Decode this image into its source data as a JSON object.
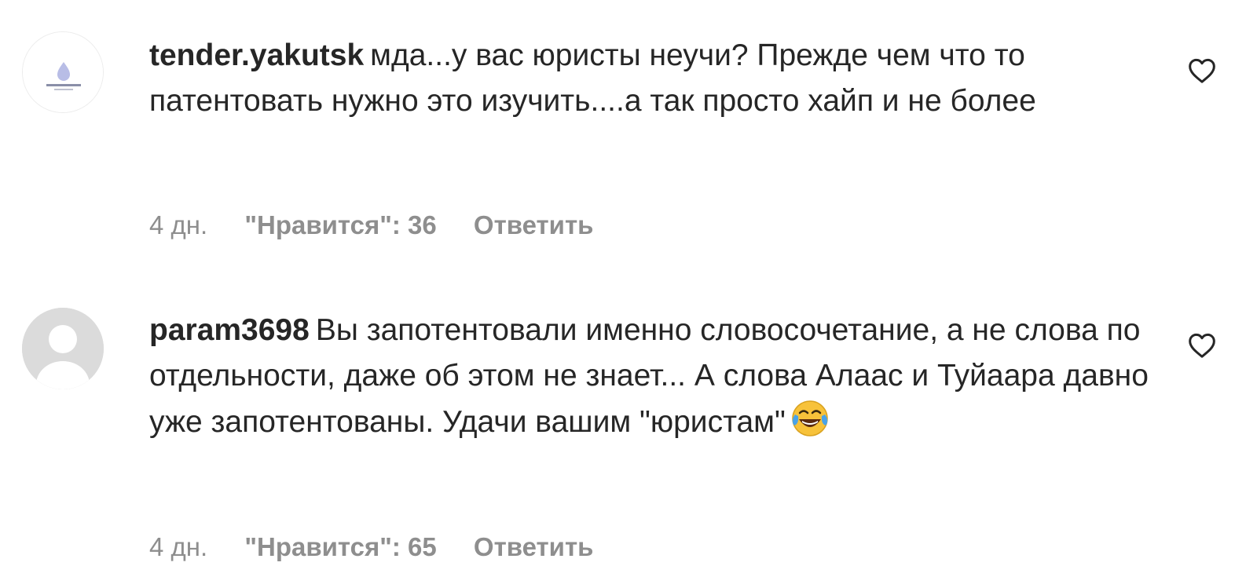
{
  "comments": [
    {
      "username": "tender.yakutsk",
      "text": "мда...у вас юристы неучи? Прежде чем что то патентовать нужно это изучить....а так просто хайп и не более",
      "time": "4 дн.",
      "likes": "\"Нравится\": 36",
      "reply_label": "Ответить",
      "avatar_icon": "logo-avatar",
      "like_icon": "heart-outline-icon"
    },
    {
      "username": "param3698",
      "text": "Вы запотентовали именно словосочетание, а не слова по отдельности, даже об этом не знает... А слова Алаас и Туйаара давно уже запотентованы. Удачи вашим \"юристам\"",
      "emoji": "laughing-crying-emoji",
      "time": "4 дн.",
      "likes": "\"Нравится\": 65",
      "reply_label": "Ответить",
      "avatar_icon": "default-avatar",
      "like_icon": "heart-outline-icon"
    }
  ],
  "colors": {
    "text": "#262626",
    "meta": "#8e8e8e",
    "avatar_placeholder": "#dbdbdb"
  }
}
